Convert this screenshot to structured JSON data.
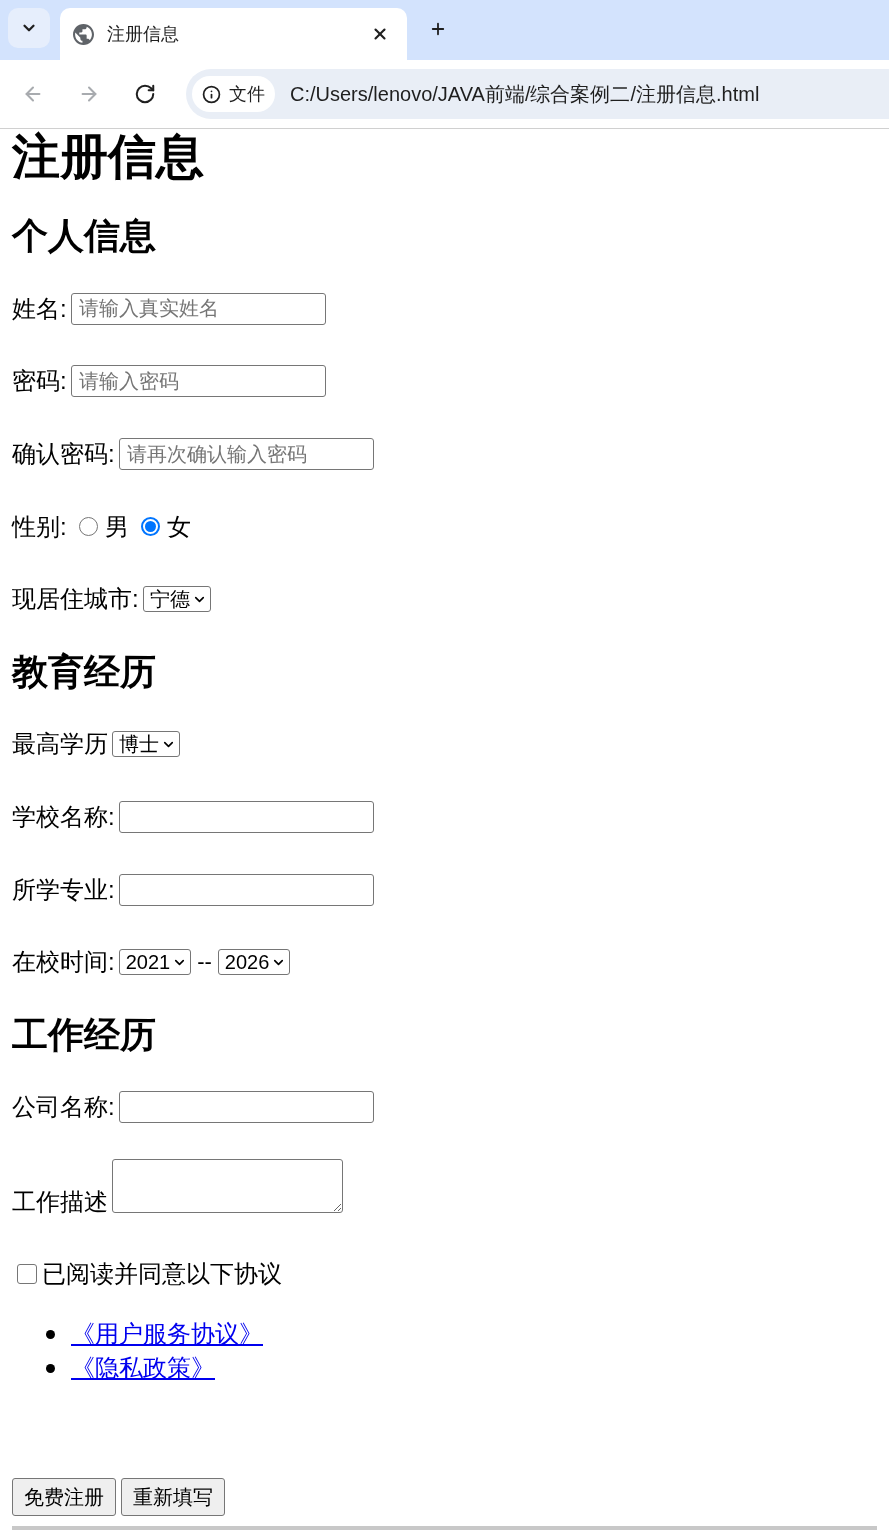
{
  "browser": {
    "tab": {
      "title": "注册信息"
    },
    "nav_buttons": [
      {
        "kind": "back",
        "disabled": true
      },
      {
        "kind": "forward",
        "disabled": true
      },
      {
        "kind": "reload",
        "disabled": false
      }
    ],
    "address_chip": "文件",
    "url": "C:/Users/lenovo/JAVA前端/综合案例二/注册信息.html"
  },
  "page": {
    "title": "注册信息",
    "sections": [
      {
        "heading": "个人信息",
        "fields": [
          {
            "kind": "text",
            "label": "姓名:",
            "placeholder": "请输入真实姓名"
          },
          {
            "kind": "text",
            "label": "密码:",
            "placeholder": "请输入密码"
          },
          {
            "kind": "text",
            "label": "确认密码:",
            "placeholder": "请再次确认输入密码"
          },
          {
            "kind": "radio",
            "label": "性别:",
            "options": [
              {
                "label": "男",
                "selected": false
              },
              {
                "label": "女",
                "selected": true
              }
            ]
          },
          {
            "kind": "select",
            "label": "现居住城市:",
            "value": "宁德"
          }
        ]
      },
      {
        "heading": "教育经历",
        "fields": [
          {
            "kind": "select",
            "label": "最高学历",
            "value": "博士"
          },
          {
            "kind": "text",
            "label": "学校名称:"
          },
          {
            "kind": "text",
            "label": "所学专业:"
          },
          {
            "kind": "range",
            "label": "在校时间:",
            "from": "2021",
            "separator": "--",
            "to": "2026"
          }
        ]
      },
      {
        "heading": "工作经历",
        "fields": [
          {
            "kind": "text",
            "label": "公司名称:"
          },
          {
            "kind": "textarea",
            "label": "工作描述"
          }
        ]
      }
    ],
    "agreement": {
      "label": "已阅读并同意以下协议",
      "checked": false
    },
    "links": [
      "《用户服务协议》",
      "《隐私政策》"
    ],
    "buttons": [
      "免费注册",
      "重新填写"
    ]
  }
}
